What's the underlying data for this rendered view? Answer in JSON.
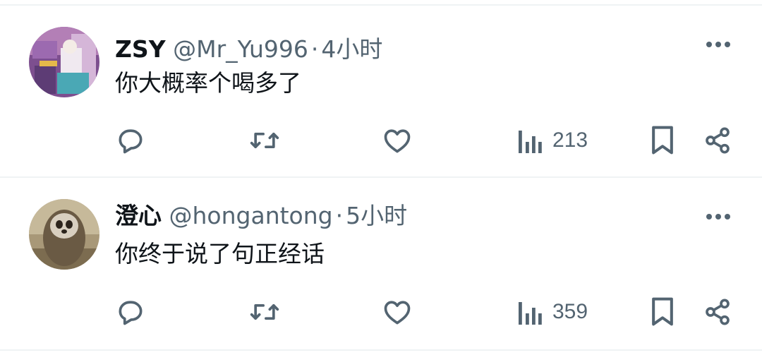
{
  "tweets": [
    {
      "display_name": "ZSY",
      "handle": "@Mr_Yu996",
      "separator": "·",
      "time": "4小时",
      "text": "你大概率个喝多了",
      "views": "213"
    },
    {
      "display_name": "澄心",
      "handle": "@hongantong",
      "separator": "·",
      "time": "5小时",
      "text": "你终于说了句正经话",
      "views": "359"
    }
  ],
  "icons": {
    "reply": "reply-icon",
    "retweet": "retweet-icon",
    "like": "heart-icon",
    "views": "views-icon",
    "bookmark": "bookmark-icon",
    "share": "share-icon",
    "more": "more-icon"
  },
  "colors": {
    "icon_gray": "#536471",
    "text_dark": "#0f1419",
    "divider": "#eff3f4"
  }
}
